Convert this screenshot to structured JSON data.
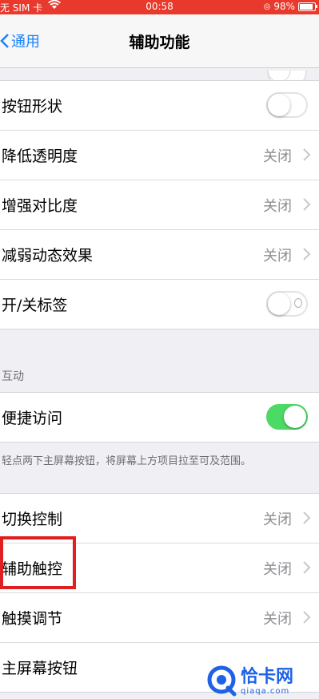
{
  "status_bar": {
    "carrier": "无 SIM 卡",
    "time": "00:58",
    "battery": "98%"
  },
  "nav": {
    "back_label": "通用",
    "title": "辅助功能"
  },
  "group1": [
    {
      "label": "按钮形状",
      "type": "toggle",
      "on": false
    },
    {
      "label": "降低透明度",
      "value": "关闭",
      "type": "link"
    },
    {
      "label": "增强对比度",
      "value": "关闭",
      "type": "link"
    },
    {
      "label": "减弱动态效果",
      "value": "关闭",
      "type": "link"
    },
    {
      "label": "开/关标签",
      "type": "toggle",
      "on": false
    }
  ],
  "interaction": {
    "header": "互动",
    "reachability": {
      "label": "便捷访问",
      "on": true
    },
    "footer": "轻点两下主屏幕按钮，将屏幕上方项目拉至可及范围。"
  },
  "group3": [
    {
      "label": "切换控制",
      "value": "关闭"
    },
    {
      "label": "辅助触控",
      "value": "关闭"
    },
    {
      "label": "触摸调节",
      "value": "关闭"
    },
    {
      "label": "主屏幕按钮",
      "value": ""
    }
  ],
  "watermark": {
    "title": "恰卡网",
    "url": "qiaqa.com"
  },
  "colors": {
    "status_bar": "#e8392c",
    "accent_blue": "#1a82fb",
    "toggle_on": "#4cd964",
    "highlight": "#e02020"
  }
}
